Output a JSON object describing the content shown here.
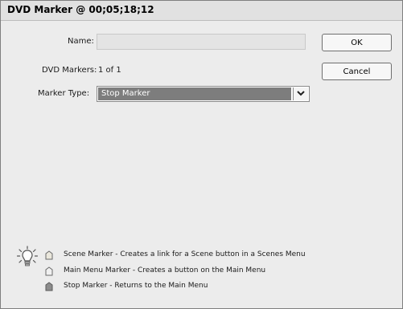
{
  "dialog": {
    "title": "DVD Marker @ 00;05;18;12"
  },
  "form": {
    "name_label": "Name:",
    "name_value": "",
    "dvd_markers_label": "DVD Markers:",
    "dvd_markers_value": "1 of 1",
    "marker_type_label": "Marker Type:",
    "marker_type_selected": "Stop Marker"
  },
  "buttons": {
    "ok_label": "OK",
    "cancel_label": "Cancel"
  },
  "legend": {
    "icon": "lightbulb-icon",
    "items": [
      {
        "icon": "scene-marker-icon",
        "text": "Scene Marker - Creates a link for a Scene button in a Scenes Menu"
      },
      {
        "icon": "main-menu-marker-icon",
        "text": "Main Menu Marker - Creates a button on the Main Menu"
      },
      {
        "icon": "stop-marker-icon",
        "text": "Stop Marker - Returns to the Main Menu"
      }
    ]
  },
  "colors": {
    "dialog_bg": "#ececec",
    "select_highlight": "#7d7d7d",
    "scene_marker": "#eae7dc",
    "main_menu_marker": "#f0f0f0",
    "stop_marker": "#8c8c8c"
  }
}
